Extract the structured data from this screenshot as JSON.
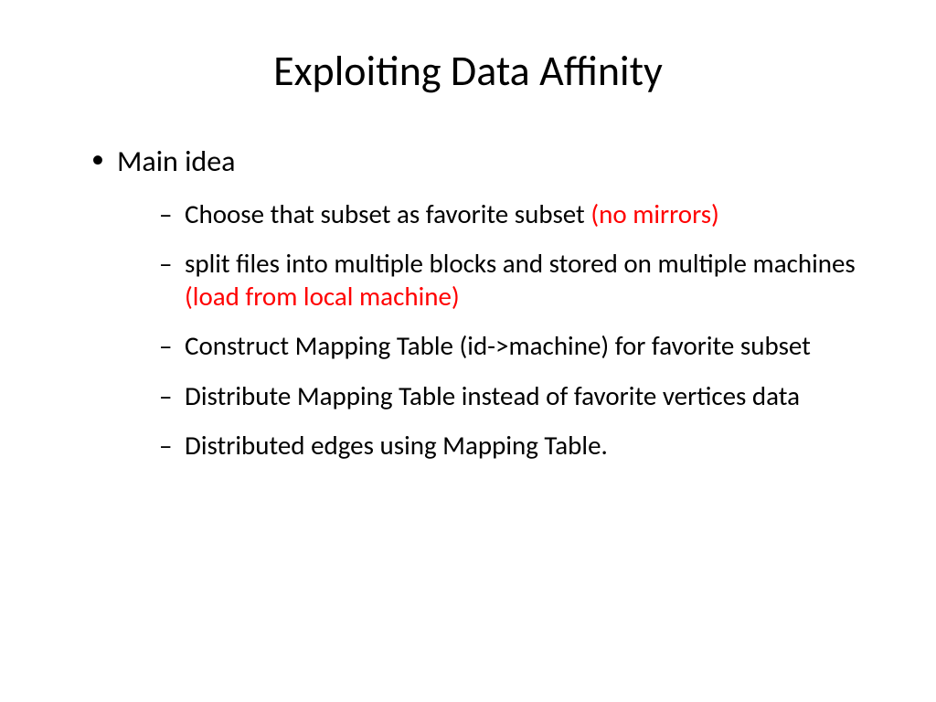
{
  "slide": {
    "title": "Exploiting Data Affinity",
    "bullet1": {
      "text": "Main idea",
      "sub": [
        {
          "prefix": "Choose that subset as favorite subset ",
          "accent": "(no mirrors)",
          "suffix": ""
        },
        {
          "prefix": "split files into multiple blocks and stored on multiple machines ",
          "accent": "(load from local machine)",
          "suffix": ""
        },
        {
          "prefix": "Construct Mapping Table (id->machine) for favorite subset",
          "accent": "",
          "suffix": ""
        },
        {
          "prefix": "Distribute Mapping Table  instead of favorite vertices data",
          "accent": "",
          "suffix": ""
        },
        {
          "prefix": "Distributed edges using Mapping Table.",
          "accent": "",
          "suffix": ""
        }
      ]
    }
  }
}
